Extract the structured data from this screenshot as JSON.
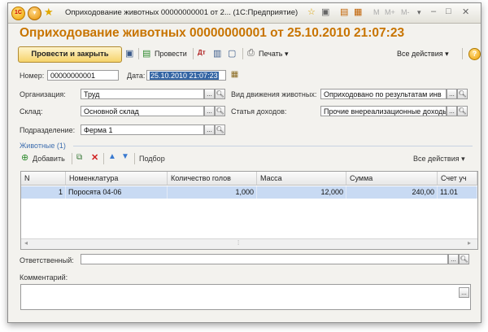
{
  "window": {
    "title": "Оприходование животных 00000000001 от 2...  (1С:Предприятие)",
    "logo_text": "1С",
    "controls": [
      "☆",
      "▣",
      "▤",
      "▦",
      "M",
      "M+",
      "M-",
      "▾",
      "–",
      "□",
      "✕"
    ]
  },
  "form": {
    "heading": "Оприходование животных 00000000001 от 25.10.2010 21:07:23"
  },
  "toolbar": {
    "post_and_close": "Провести и закрыть",
    "post": "Провести",
    "print": "Печать ▾",
    "all_actions": "Все действия ▾",
    "help": "?"
  },
  "fields": {
    "number_label": "Номер:",
    "number_value": "00000000001",
    "date_label": "Дата:",
    "date_value": "25.10.2010 21:07:23",
    "org_label": "Организация:",
    "org_value": "Труд",
    "warehouse_label": "Склад:",
    "warehouse_value": "Основной склад",
    "division_label": "Подразделение:",
    "division_value": "Ферма 1",
    "movement_label": "Вид движения животных:",
    "movement_value": "Оприходовано по результатам инв",
    "income_label": "Статья доходов:",
    "income_value": "Прочие внереализационные доходы"
  },
  "animals": {
    "group_title": "Животные (1)",
    "add": "Добавить",
    "selection": "Подбор",
    "all_actions": "Все действия ▾",
    "columns": [
      "N",
      "Номенклатура",
      "Количество голов",
      "Масса",
      "Сумма",
      "Счет уч"
    ],
    "rows": [
      {
        "n": "1",
        "item": "Поросята 04-06",
        "qty": "1,000",
        "mass": "12,000",
        "sum": "240,00",
        "account": "11.01"
      }
    ]
  },
  "footer": {
    "responsible_label": "Ответственный:",
    "responsible_value": "",
    "comment_label": "Комментарий:",
    "comment_value": ""
  }
}
